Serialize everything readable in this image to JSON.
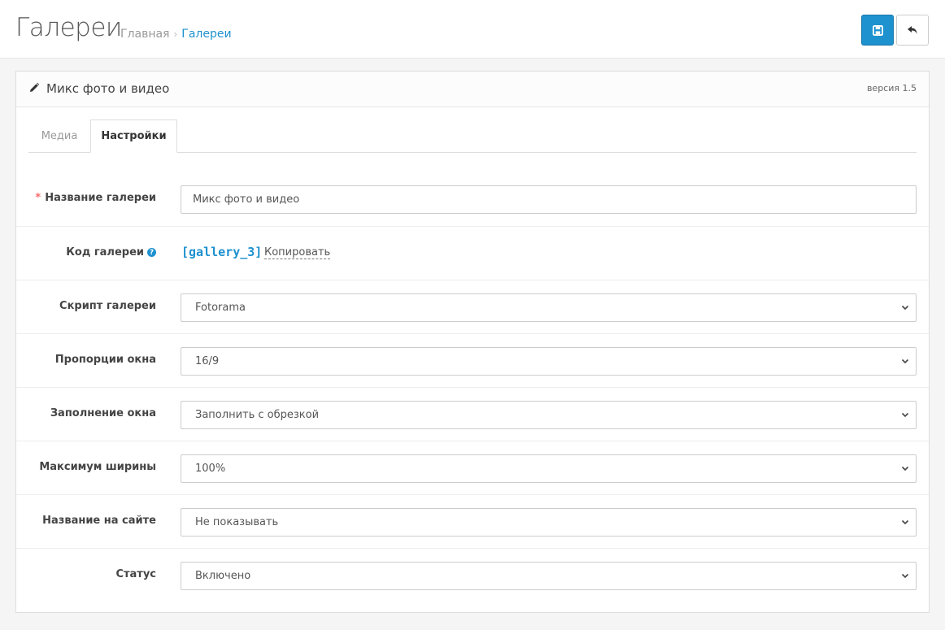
{
  "header": {
    "title": "Галереи",
    "breadcrumb": {
      "home": "Главная",
      "separator": "›",
      "current": "Галереи"
    }
  },
  "panel": {
    "title": "Микс фото и видео",
    "version": "версия 1.5"
  },
  "tabs": [
    {
      "label": "Медиа",
      "active": false
    },
    {
      "label": "Настройки",
      "active": true
    }
  ],
  "form": {
    "name": {
      "required_mark": "*",
      "label": "Название галереи",
      "value": "Микс фото и видео"
    },
    "code": {
      "label": "Код галереи",
      "help": "?",
      "value": "[gallery_3]",
      "copy": "Копировать"
    },
    "script": {
      "label": "Скрипт галереи",
      "value": "Fotorama"
    },
    "ratio": {
      "label": "Пропорции окна",
      "value": "16/9"
    },
    "fill": {
      "label": "Заполнение окна",
      "value": "Заполнить с обрезкой"
    },
    "max_width": {
      "label": "Максимум ширины",
      "value": "100%"
    },
    "site_title": {
      "label": "Название на сайте",
      "value": "Не показывать"
    },
    "status": {
      "label": "Статус",
      "value": "Включено"
    }
  },
  "colors": {
    "accent": "#1e91cf",
    "required": "#f56b6b"
  },
  "icons": {
    "save": "floppy-icon",
    "back": "reply-icon",
    "edit": "pencil-icon",
    "select": "chevron-down-icon"
  }
}
